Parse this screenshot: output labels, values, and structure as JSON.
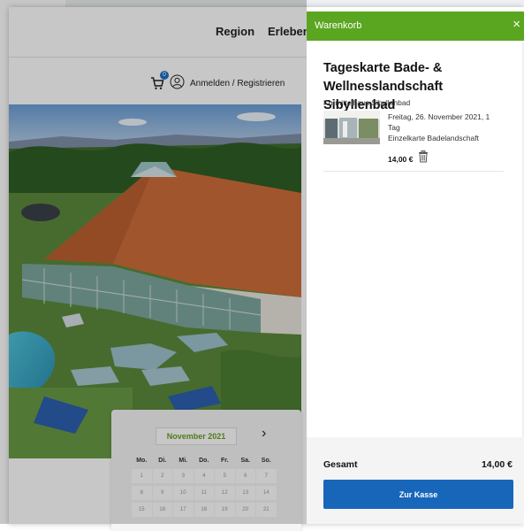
{
  "nav": {
    "links": [
      "Region",
      "Erleben"
    ]
  },
  "account": {
    "cart_count": "0",
    "login_label": "Anmelden / Registrieren"
  },
  "calendar": {
    "month": "November 2021",
    "next_glyph": "›",
    "weekdays": [
      "Mo.",
      "Di.",
      "Mi.",
      "Do.",
      "Fr.",
      "Sa.",
      "So."
    ],
    "days": [
      "1",
      "2",
      "3",
      "4",
      "5",
      "6",
      "7",
      "8",
      "9",
      "10",
      "11",
      "12",
      "13",
      "14",
      "15",
      "16",
      "17",
      "18",
      "19",
      "20",
      "21"
    ]
  },
  "cart": {
    "title": "Warenkorb",
    "close_glyph": "×",
    "item": {
      "title": "Tageskarte Bade- & Wellnesslandschaft Sibyllenbad",
      "venue": "Kurmittelhaus Sibyllenbad",
      "date": "Freitag, 26. November 2021, 1 Tag",
      "ticket": "Einzelkarte Badelandschaft",
      "price": "14,00 €"
    },
    "total_label": "Gesamt",
    "total_value": "14,00 €",
    "checkout_label": "Zur Kasse"
  },
  "colors": {
    "header_green": "#5aa620",
    "button_blue": "#1766ba",
    "month_green": "#6a9f24"
  }
}
